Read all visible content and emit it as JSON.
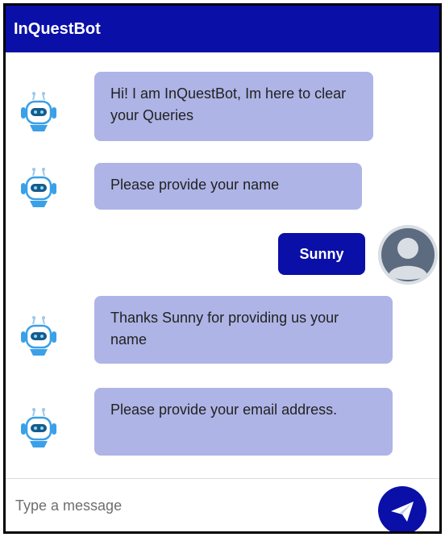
{
  "header": {
    "title": "InQuestBot",
    "background": "#0a0fa8"
  },
  "messages": [
    {
      "sender": "bot",
      "text": "Hi! I am InQuestBot, Im here to clear your Queries"
    },
    {
      "sender": "bot",
      "text": "Please provide your name"
    },
    {
      "sender": "user",
      "text": "Sunny"
    },
    {
      "sender": "bot",
      "text": "Thanks Sunny for providing us your name"
    },
    {
      "sender": "bot",
      "text": "Please provide your email address."
    }
  ],
  "input": {
    "placeholder": "Type a message",
    "value": ""
  },
  "icons": {
    "bot": "robot-icon",
    "user": "user-avatar-icon",
    "send": "paper-plane-icon"
  },
  "colors": {
    "accent": "#0a0fa8",
    "bot_bubble": "#aeb4e6",
    "bot_icon": "#3aa0e8"
  }
}
